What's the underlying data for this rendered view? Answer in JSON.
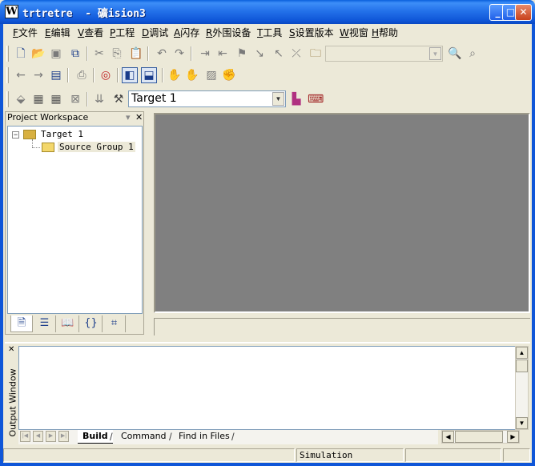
{
  "window": {
    "title": "trtretre  - 礦ision3",
    "icon_glyph": "W",
    "minimize": "_",
    "maximize": "□",
    "close": "✕"
  },
  "menu": [
    {
      "key": "F",
      "label": "文件"
    },
    {
      "key": "E",
      "label": "编辑"
    },
    {
      "key": "V",
      "label": "查看"
    },
    {
      "key": "P",
      "label": "工程"
    },
    {
      "key": "D",
      "label": "调试"
    },
    {
      "key": "A",
      "label": "闪存"
    },
    {
      "key": "R",
      "label": "外围设备"
    },
    {
      "key": "T",
      "label": "工具"
    },
    {
      "key": "S",
      "label": "设置版本"
    },
    {
      "key": "W",
      "label": "视窗"
    },
    {
      "key": "H",
      "label": "帮助"
    }
  ],
  "toolbar1": {
    "icons": [
      "new-file-icon",
      "open-folder-icon",
      "save-icon",
      "save-all-icon",
      "cut-icon",
      "copy-icon",
      "paste-icon",
      "undo-icon",
      "redo-icon",
      "indent-icon",
      "unindent-icon",
      "bookmark-toggle-icon",
      "bookmark-next-icon",
      "bookmark-prev-icon",
      "bookmark-clear-icon",
      "find-in-files-icon",
      "find-icon",
      "incremental-find-icon"
    ],
    "find_value": ""
  },
  "toolbar2": {
    "icons": [
      "back-icon",
      "forward-icon",
      "browse-icon",
      "print-icon",
      "debug-start-icon",
      "workspace-toggle-icon",
      "output-toggle-icon",
      "hand-icon",
      "hand-stop-icon",
      "breakpoint-icon",
      "hand-grab-icon"
    ]
  },
  "toolbar3": {
    "icons": [
      "translate-icon",
      "build-icon",
      "rebuild-icon",
      "stop-build-icon",
      "load-icon",
      "target-options-icon",
      "manage-components-icon",
      "configure-icon"
    ],
    "target_value": "Target 1"
  },
  "workspace": {
    "title": "Project Workspace",
    "pin": "▾",
    "close": "✕",
    "tree": [
      {
        "label": "Target 1",
        "expander": "−"
      },
      {
        "label": "Source Group 1"
      }
    ],
    "tabs": [
      "files-tab-icon",
      "regs-tab-icon",
      "books-tab-icon",
      "functions-tab-icon",
      "templates-tab-icon"
    ]
  },
  "output": {
    "close": "✕",
    "title": "Output Window",
    "tabs": [
      {
        "label": "Build",
        "active": true
      },
      {
        "label": "Command",
        "active": false
      },
      {
        "label": "Find in Files",
        "active": false
      }
    ]
  },
  "status": {
    "mode": "Simulation"
  }
}
